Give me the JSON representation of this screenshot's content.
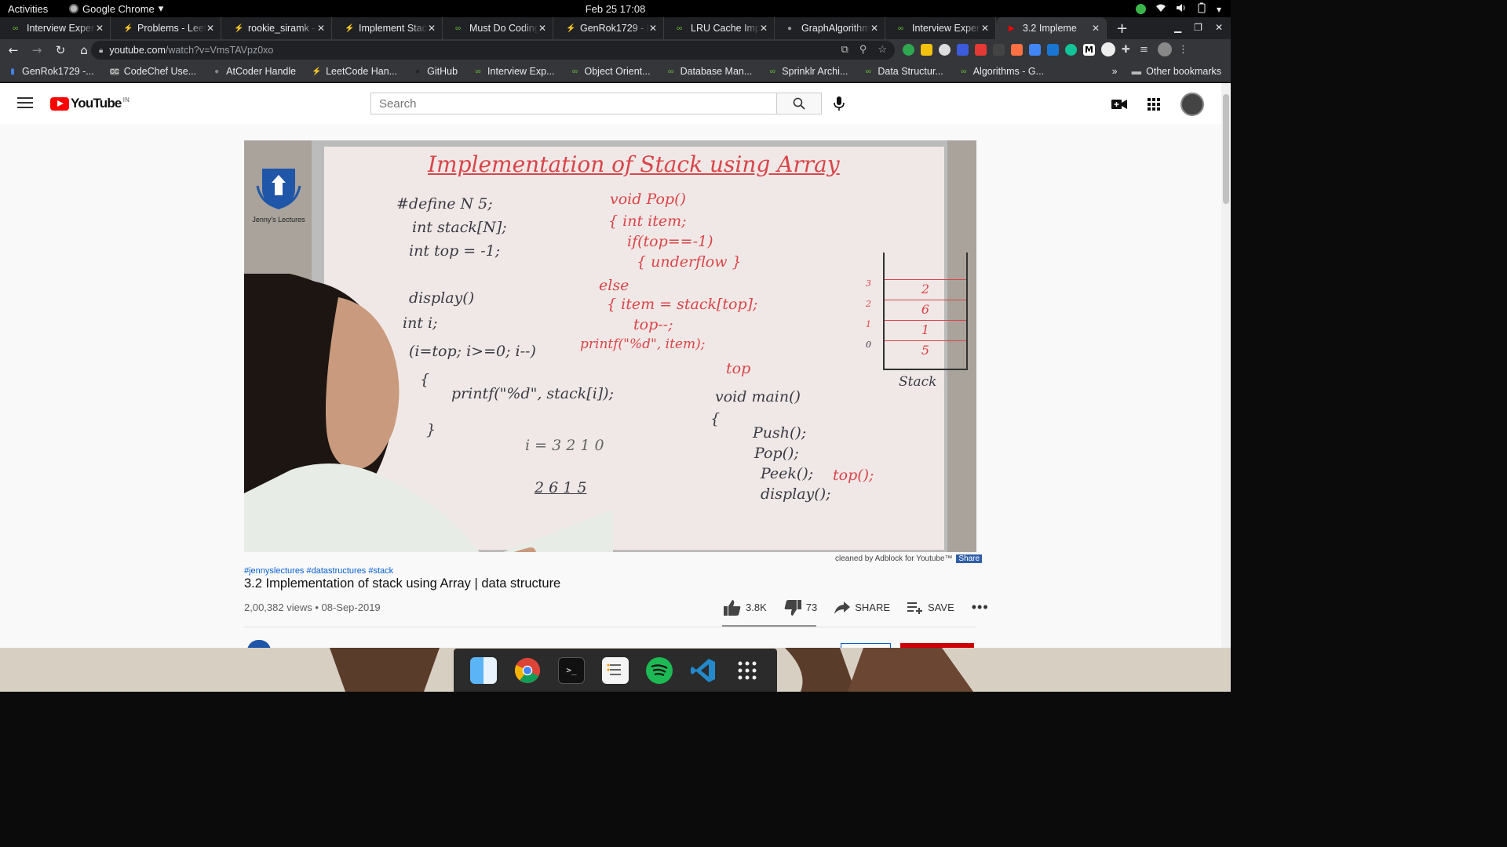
{
  "system_bar": {
    "activities": "Activities",
    "app_name": "Google Chrome",
    "datetime": "Feb 25  17:08"
  },
  "tabs": [
    {
      "title": "Interview Exper",
      "icon": "geeksforgeeks-icon"
    },
    {
      "title": "Problems - Leet",
      "icon": "leetcode-icon"
    },
    {
      "title": "rookie_siramk -",
      "icon": "leetcode-icon"
    },
    {
      "title": "Implement Stac",
      "icon": "leetcode-icon"
    },
    {
      "title": "Must Do Coding",
      "icon": "geeksforgeeks-icon"
    },
    {
      "title": "GenRok1729 - L",
      "icon": "leetcode-icon"
    },
    {
      "title": "LRU Cache Impl",
      "icon": "geeksforgeeks-icon"
    },
    {
      "title": "GraphAlgorithm",
      "icon": "github-icon"
    },
    {
      "title": "Interview Exper",
      "icon": "geeksforgeeks-icon"
    },
    {
      "title": "3.2 Impleme",
      "icon": "youtube-icon",
      "active": true
    }
  ],
  "address_bar": {
    "host": "youtube.com",
    "path": "/watch?v=VmsTAVpz0xo"
  },
  "bookmarks": [
    {
      "label": "GenRok1729 -...",
      "icon": "bar-chart-icon"
    },
    {
      "label": "CodeChef Use...",
      "icon": "codechef-icon"
    },
    {
      "label": "AtCoder Handle",
      "icon": "atcoder-icon"
    },
    {
      "label": "LeetCode Han...",
      "icon": "leetcode-icon"
    },
    {
      "label": "GitHub",
      "icon": "github-icon"
    },
    {
      "label": "Interview Exp...",
      "icon": "geeksforgeeks-icon"
    },
    {
      "label": "Object Orient...",
      "icon": "geeksforgeeks-icon"
    },
    {
      "label": "Database Man...",
      "icon": "geeksforgeeks-icon"
    },
    {
      "label": "Sprinklr Archi...",
      "icon": "geeksforgeeks-icon"
    },
    {
      "label": "Data Structur...",
      "icon": "geeksforgeeks-icon"
    },
    {
      "label": "Algorithms - G...",
      "icon": "geeksforgeeks-icon"
    }
  ],
  "bookmarks_more": "»",
  "other_bookmarks": "Other bookmarks",
  "youtube": {
    "logo_text": "YouTube",
    "country_code": "IN",
    "search_placeholder": "Search"
  },
  "video": {
    "channel_logo_text": "Jenny's Lectures",
    "board": {
      "title": "Implementation of Stack using Array",
      "lines_left": [
        "#define N 5;",
        "int stack[N];",
        "int top = -1;",
        "display()",
        "int i;",
        "(i=top; i>=0; i--)",
        "{",
        "printf(\"%d\", stack[i]);",
        "}",
        "i = 3 2 1 0",
        "2 6 1 5"
      ],
      "lines_right": [
        "void Pop()",
        "{ int item;",
        "if(top==-1)",
        "{ underflow }",
        "else",
        "{ item = stack[top];",
        "top--;",
        "printf(\"%d\", item);",
        "top",
        "void main()",
        "{",
        "Push();",
        "Pop();",
        "Peek();",
        "top();",
        "display();"
      ],
      "stack_values": [
        "2",
        "6",
        "1",
        "5"
      ],
      "stack_indices": [
        "3",
        "2",
        "1",
        "0"
      ],
      "stack_label": "Stack"
    }
  },
  "adblock_note": "cleaned by Adblock for Youtube™",
  "adblock_share": "Share",
  "hashtags": "#jennyslectures #datastructures #stack",
  "video_title": "3.2 Implementation of stack using Array | data structure",
  "video_meta": "2,00,382 views • 08-Sep-2019",
  "actions": {
    "likes": "3.8K",
    "dislikes": "73",
    "share": "SHARE",
    "save": "SAVE"
  }
}
